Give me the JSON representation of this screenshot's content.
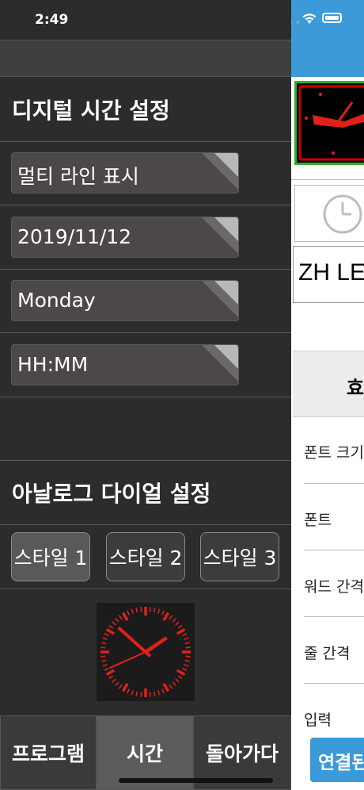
{
  "status": {
    "time": "2:49"
  },
  "digital_section": {
    "title": "디지털 시간 설정",
    "dropdowns": [
      {
        "label": "멀티 라인 표시"
      },
      {
        "label": "2019/11/12"
      },
      {
        "label": "Monday"
      },
      {
        "label": "HH:MM"
      }
    ]
  },
  "analog_section": {
    "title": "아날로그 다이얼 설정",
    "styles": [
      {
        "label": "스타일 1",
        "selected": true
      },
      {
        "label": "스타일 2",
        "selected": false
      },
      {
        "label": "스타일 3",
        "selected": false
      }
    ],
    "clock_preview": {
      "hour": 1,
      "minute": 52,
      "second": 41,
      "color": "#e0211b"
    }
  },
  "tabs": [
    {
      "label": "프로그램",
      "active": false
    },
    {
      "label": "시간",
      "active": true
    },
    {
      "label": "돌아가다",
      "active": false
    }
  ],
  "right_panel": {
    "preview_text": "ZH LE",
    "header_label": "효",
    "rows": [
      "폰트 크기",
      "폰트",
      "워드 간격",
      "줄 간격",
      "입력"
    ],
    "connect_button": "연결된"
  },
  "colors": {
    "accent_blue": "#3d9ad8",
    "clock_red": "#e0211b",
    "border_green": "#29b32d"
  }
}
